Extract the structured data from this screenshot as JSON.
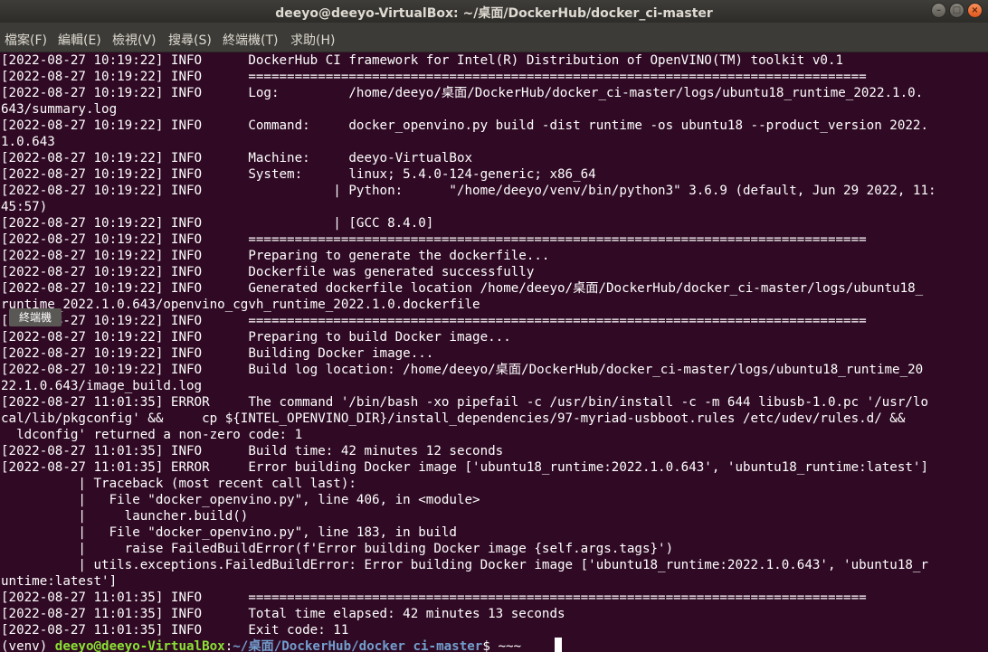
{
  "window": {
    "title": "deeyo@deeyo-VirtualBox: ~/桌面/DockerHub/docker_ci-master"
  },
  "menu": [
    "檔案(F)",
    "編輯(E)",
    "檢視(V)",
    "搜尋(S)",
    "終端機(T)",
    "求助(H)"
  ],
  "tooltip": "終端機",
  "terminal": {
    "lines": [
      "[2022-08-27 10:19:22] INFO      DockerHub CI framework for Intel(R) Distribution of OpenVINO(TM) toolkit v0.1",
      "[2022-08-27 10:19:22] INFO      ================================================================================",
      "[2022-08-27 10:19:22] INFO      Log:         /home/deeyo/桌面/DockerHub/docker_ci-master/logs/ubuntu18_runtime_2022.1.0.",
      "643/summary.log",
      "[2022-08-27 10:19:22] INFO      Command:     docker_openvino.py build -dist runtime -os ubuntu18 --product_version 2022.",
      "1.0.643",
      "[2022-08-27 10:19:22] INFO      Machine:     deeyo-VirtualBox",
      "[2022-08-27 10:19:22] INFO      System:      linux; 5.4.0-124-generic; x86_64",
      "[2022-08-27 10:19:22] INFO                 | Python:      \"/home/deeyo/venv/bin/python3\" 3.6.9 (default, Jun 29 2022, 11:",
      "45:57)",
      "[2022-08-27 10:19:22] INFO                 | [GCC 8.4.0]",
      "[2022-08-27 10:19:22] INFO      ================================================================================",
      "[2022-08-27 10:19:22] INFO      Preparing to generate the dockerfile...",
      "[2022-08-27 10:19:22] INFO      Dockerfile was generated successfully",
      "[2022-08-27 10:19:22] INFO      Generated dockerfile location /home/deeyo/桌面/DockerHub/docker_ci-master/logs/ubuntu18_",
      "runtime_2022.1.0.643/openvino_cgvh_runtime_2022.1.0.dockerfile",
      "[2022-08-27 10:19:22] INFO      ================================================================================",
      "[2022-08-27 10:19:22] INFO      Preparing to build Docker image...",
      "[2022-08-27 10:19:22] INFO      Building Docker image...",
      "[2022-08-27 10:19:22] INFO      Build log location: /home/deeyo/桌面/DockerHub/docker_ci-master/logs/ubuntu18_runtime_20",
      "22.1.0.643/image_build.log",
      "[2022-08-27 11:01:35] ERROR     The command '/bin/bash -xo pipefail -c /usr/bin/install -c -m 644 libusb-1.0.pc '/usr/lo",
      "cal/lib/pkgconfig' &&     cp ${INTEL_OPENVINO_DIR}/install_dependencies/97-myriad-usbboot.rules /etc/udev/rules.d/ &&",
      "  ldconfig' returned a non-zero code: 1",
      "[2022-08-27 11:01:35] INFO      Build time: 42 minutes 12 seconds",
      "[2022-08-27 11:01:35] ERROR     Error building Docker image ['ubuntu18_runtime:2022.1.0.643', 'ubuntu18_runtime:latest']",
      "          | Traceback (most recent call last):",
      "          |   File \"docker_openvino.py\", line 406, in <module>",
      "          |     launcher.build()",
      "          |   File \"docker_openvino.py\", line 183, in build",
      "          |     raise FailedBuildError(f'Error building Docker image {self.args.tags}')",
      "          | utils.exceptions.FailedBuildError: Error building Docker image ['ubuntu18_runtime:2022.1.0.643', 'ubuntu18_r",
      "untime:latest']",
      "[2022-08-27 11:01:35] INFO      ================================================================================",
      "[2022-08-27 11:01:35] INFO      Total time elapsed: 42 minutes 13 seconds",
      "[2022-08-27 11:01:35] INFO      Exit code: 11"
    ],
    "prompt": {
      "venv": "(venv) ",
      "userhost": "deeyo@deeyo-VirtualBox",
      "sep": ":",
      "path": "~/桌面/DockerHub/docker_ci-master",
      "dollar": "$ ",
      "input": "~~~"
    }
  },
  "colors": {
    "background": "#300a24",
    "prompt_user": "#8ae234",
    "prompt_path": "#729fcf",
    "text": "#ffffff"
  }
}
